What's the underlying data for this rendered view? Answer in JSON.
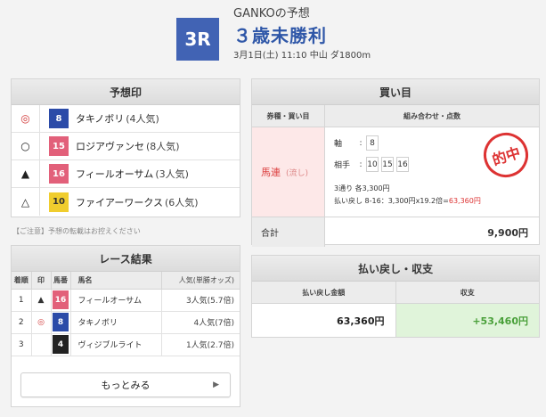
{
  "header": {
    "predictor": "GANKOの予想",
    "race_no": "3R",
    "race_name": "３歳未勝利",
    "race_info": "3月1日(土) 11:10 中山 ダ1800m"
  },
  "prediction": {
    "title": "予想印",
    "rows": [
      {
        "mark": "◎",
        "num": "8",
        "name": "タキノボリ",
        "pop": "(4人気)",
        "color": "#2b4ba8",
        "text_color": "#ffffff"
      },
      {
        "mark": "○",
        "num": "15",
        "name": "ロジアヴァンセ",
        "pop": "(8人気)",
        "color": "#e2607a",
        "text_color": "#ffffff"
      },
      {
        "mark": "▲",
        "num": "16",
        "name": "フィールオーサム",
        "pop": "(3人気)",
        "color": "#e2607a",
        "text_color": "#ffffff"
      },
      {
        "mark": "△",
        "num": "10",
        "name": "ファイアーワークス",
        "pop": "(6人気)",
        "color": "#f0cd2e",
        "text_color": "#333333"
      }
    ],
    "note": "【ご注意】予想の転載はお控えください"
  },
  "results": {
    "title": "レース結果",
    "headers": {
      "rank": "着順",
      "mark": "印",
      "num": "馬番",
      "name": "馬名",
      "pop": "人気(単勝オッズ)"
    },
    "rows": [
      {
        "rank": "1",
        "mark": "▲",
        "num": "16",
        "name": "フィールオーサム",
        "pop": "3人気(5.7倍)",
        "color": "#e2607a",
        "text_color": "#ffffff"
      },
      {
        "rank": "2",
        "mark": "◎",
        "num": "8",
        "name": "タキノボリ",
        "pop": "4人気(7倍)",
        "color": "#2b4ba8",
        "text_color": "#ffffff"
      },
      {
        "rank": "3",
        "mark": "",
        "num": "4",
        "name": "ヴィジブルライト",
        "pop": "1人気(2.7倍)",
        "color": "#222222",
        "text_color": "#ffffff"
      }
    ],
    "more_label": "もっとみる",
    "more_chevron": "▶"
  },
  "bet": {
    "title": "買い目",
    "head_type": "券種・買い目",
    "head_combo": "組み合わせ・点数",
    "type": "馬連",
    "type_sub": "(流し)",
    "axis_label": "軸",
    "axis_nums": [
      "8"
    ],
    "partner_label": "相手",
    "partner_nums": [
      "10",
      "15",
      "16"
    ],
    "summary_line1": "3通り 各3,300円",
    "summary_line2_prefix": "払い戻し 8-16：3,300円x19.2倍=",
    "summary_line2_hit": "63,360円",
    "stamp": "的中",
    "total_label": "合計",
    "total_value": "9,900円"
  },
  "payout": {
    "title": "払い戻し・収支",
    "head_payout": "払い戻し金額",
    "head_balance": "収支",
    "payout_value": "63,360円",
    "balance_value": "+53,460円"
  }
}
